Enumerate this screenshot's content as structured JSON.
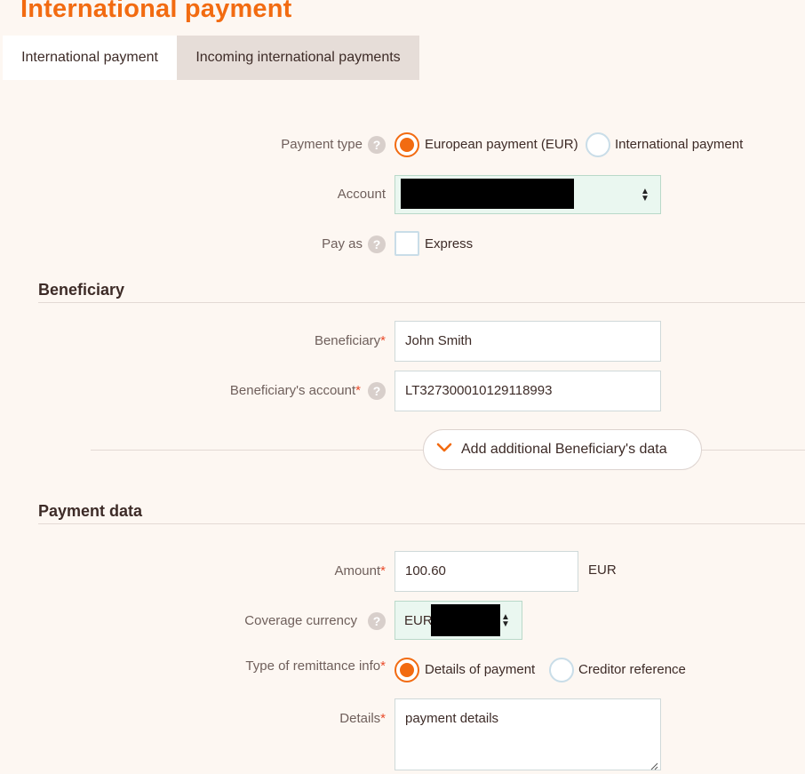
{
  "page_title": "International payment",
  "tabs": [
    {
      "label": "International payment",
      "active": true
    },
    {
      "label": "Incoming international payments",
      "active": false
    }
  ],
  "form": {
    "payment_type": {
      "label": "Payment type",
      "options": [
        {
          "label": "European payment (EUR)",
          "selected": true
        },
        {
          "label": "International payment",
          "selected": false
        }
      ]
    },
    "account": {
      "label": "Account",
      "value": ""
    },
    "pay_as": {
      "label": "Pay as",
      "checkbox_label": "Express",
      "checked": false
    }
  },
  "beneficiary": {
    "title": "Beneficiary",
    "name_label": "Beneficiary",
    "name_value": "John Smith",
    "account_label": "Beneficiary's account",
    "account_value": "LT327300010129118993",
    "add_button_label": "Add additional Beneficiary's data"
  },
  "payment_data": {
    "title": "Payment data",
    "amount_label": "Amount",
    "amount_value": "100.60",
    "amount_currency": "EUR",
    "coverage_label": "Coverage currency",
    "coverage_value": "EUR",
    "remittance_label": "Type of remittance info",
    "remittance_options": [
      {
        "label": "Details of payment",
        "selected": true
      },
      {
        "label": "Creditor reference",
        "selected": false
      }
    ],
    "details_label": "Details",
    "details_value": "payment details"
  },
  "required_marker": "*",
  "help_glyph": "?",
  "colors": {
    "accent": "#f26b11",
    "background": "#fdf7f2",
    "select_bg": "#eaf7f0",
    "required": "#e94b2b"
  },
  "icons": {
    "help": "question-circle-icon",
    "chevron": "chevron-down-icon",
    "select_arrows": "sort-arrows-icon",
    "resize": "resize-handle-icon"
  }
}
